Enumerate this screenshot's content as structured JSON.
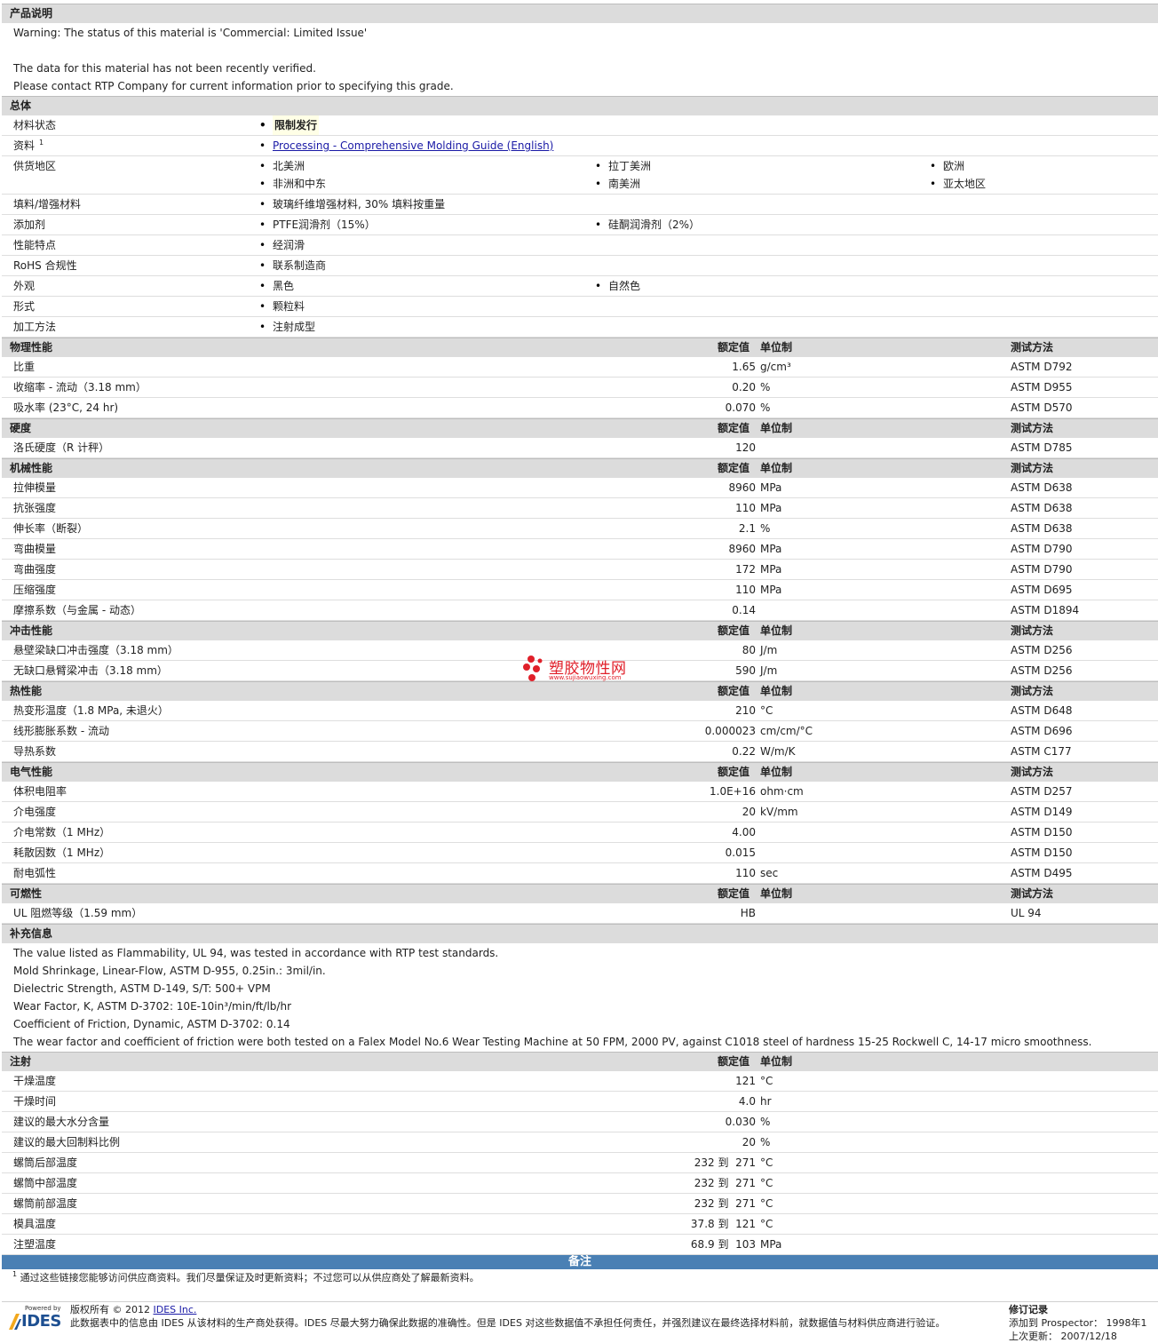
{
  "product": {
    "title": "产品说明",
    "lines": [
      "Warning: The status of this material is 'Commercial: Limited Issue'",
      "",
      "The data for this material has not been recently verified.",
      "Please contact RTP Company for current information prior to specifying this grade."
    ]
  },
  "general": {
    "title": "总体",
    "rows": [
      {
        "label": "材料状态",
        "items": [
          "限制发行"
        ],
        "highlight": true
      },
      {
        "label": "资料",
        "sup": "1",
        "items": [
          "Processing - Comprehensive Molding Guide (English)"
        ],
        "link": true
      },
      {
        "label": "供货地区",
        "items": [
          "北美洲",
          "拉丁美洲",
          "欧洲",
          "非洲和中东",
          "南美洲",
          "亚太地区"
        ]
      },
      {
        "label": "填料/增强材料",
        "items": [
          "玻璃纤维增强材料, 30% 填料按重量"
        ]
      },
      {
        "label": "添加剂",
        "items": [
          "PTFE润滑剂（15%）",
          "硅酮润滑剂（2%）"
        ]
      },
      {
        "label": "性能特点",
        "items": [
          "经润滑"
        ]
      },
      {
        "label": "RoHS 合规性",
        "items": [
          "联系制造商"
        ]
      },
      {
        "label": "外观",
        "items": [
          "黑色",
          "自然色"
        ]
      },
      {
        "label": "形式",
        "items": [
          "颗粒料"
        ]
      },
      {
        "label": "加工方法",
        "items": [
          "注射成型"
        ]
      }
    ]
  },
  "headers": {
    "nominal": "额定值",
    "unit": "单位制",
    "test": "测试方法"
  },
  "sections": [
    {
      "title": "物理性能",
      "test": true,
      "rows": [
        {
          "label": "比重",
          "value": "1.65",
          "unit": "g/cm³",
          "test": "ASTM D792"
        },
        {
          "label": "收缩率 - 流动（3.18 mm）",
          "value": "0.20",
          "unit": "%",
          "test": "ASTM D955"
        },
        {
          "label": "吸水率 (23°C, 24 hr)",
          "value": "0.070",
          "unit": "%",
          "test": "ASTM D570"
        }
      ]
    },
    {
      "title": "硬度",
      "test": true,
      "rows": [
        {
          "label": "洛氏硬度（R 计秤）",
          "value": "120",
          "unit": "",
          "test": "ASTM D785"
        }
      ]
    },
    {
      "title": "机械性能",
      "test": true,
      "rows": [
        {
          "label": "拉伸模量",
          "value": "8960",
          "unit": "MPa",
          "test": "ASTM D638"
        },
        {
          "label": "抗张强度",
          "value": "110",
          "unit": "MPa",
          "test": "ASTM D638"
        },
        {
          "label": "伸长率（断裂）",
          "value": "2.1",
          "unit": "%",
          "test": "ASTM D638"
        },
        {
          "label": "弯曲模量",
          "value": "8960",
          "unit": "MPa",
          "test": "ASTM D790"
        },
        {
          "label": "弯曲强度",
          "value": "172",
          "unit": "MPa",
          "test": "ASTM D790"
        },
        {
          "label": "压缩强度",
          "value": "110",
          "unit": "MPa",
          "test": "ASTM D695"
        },
        {
          "label": "摩擦系数（与金属 - 动态）",
          "value": "0.14",
          "unit": "",
          "test": "ASTM D1894"
        }
      ]
    },
    {
      "title": "冲击性能",
      "test": true,
      "rows": [
        {
          "label": "悬壁梁缺口冲击强度（3.18 mm）",
          "value": "80",
          "unit": "J/m",
          "test": "ASTM D256"
        },
        {
          "label": "无缺口悬臂梁冲击（3.18 mm）",
          "value": "590",
          "unit": "J/m",
          "test": "ASTM D256"
        }
      ]
    },
    {
      "title": "热性能",
      "test": true,
      "rows": [
        {
          "label": "热变形温度（1.8 MPa, 未退火）",
          "value": "210",
          "unit": "°C",
          "test": "ASTM D648"
        },
        {
          "label": "线形膨胀系数 - 流动",
          "value": "0.000023",
          "unit": "cm/cm/°C",
          "test": "ASTM D696"
        },
        {
          "label": "导热系数",
          "value": "0.22",
          "unit": "W/m/K",
          "test": "ASTM C177"
        }
      ]
    },
    {
      "title": "电气性能",
      "test": true,
      "rows": [
        {
          "label": "体积电阻率",
          "value": "1.0E+16",
          "unit": "ohm·cm",
          "test": "ASTM D257"
        },
        {
          "label": "介电强度",
          "value": "20",
          "unit": "kV/mm",
          "test": "ASTM D149"
        },
        {
          "label": "介电常数（1 MHz）",
          "value": "4.00",
          "unit": "",
          "test": "ASTM D150"
        },
        {
          "label": "耗散因数（1 MHz）",
          "value": "0.015",
          "unit": "",
          "test": "ASTM D150"
        },
        {
          "label": "耐电弧性",
          "value": "110",
          "unit": "sec",
          "test": "ASTM D495"
        }
      ]
    },
    {
      "title": "可燃性",
      "test": true,
      "rows": [
        {
          "label": "UL 阻燃等级（1.59 mm）",
          "value": "HB",
          "unit": "",
          "test": "UL 94"
        }
      ]
    }
  ],
  "supplement": {
    "title": "补充信息",
    "lines": [
      "The value listed as Flammability, UL 94, was tested in accordance with RTP test standards.",
      "Mold Shrinkage, Linear-Flow, ASTM D-955, 0.25in.: 3mil/in.",
      "Dielectric Strength, ASTM D-149, S/T: 500+ VPM",
      "Wear Factor, K, ASTM D-3702: 10E-10in³/min/ft/lb/hr",
      "Coefficient of Friction, Dynamic, ASTM D-3702: 0.14",
      "The wear factor and coefficient of friction were both tested on a Falex Model No.6 Wear Testing Machine at 50 FPM, 2000 PV, against C1018 steel of hardness 15-25 Rockwell C, 14-17 micro smoothness."
    ]
  },
  "injection": {
    "title": "注射",
    "rows": [
      {
        "label": "干燥温度",
        "value": "121",
        "unit": "°C"
      },
      {
        "label": "干燥时间",
        "value": "4.0",
        "unit": "hr"
      },
      {
        "label": "建议的最大水分含量",
        "value": "0.030",
        "unit": "%"
      },
      {
        "label": "建议的最大回制料比例",
        "value": "20",
        "unit": "%"
      },
      {
        "label": "螺筒后部温度",
        "value": "232 到  271",
        "unit": "°C"
      },
      {
        "label": "螺筒中部温度",
        "value": "232 到  271",
        "unit": "°C"
      },
      {
        "label": "螺筒前部温度",
        "value": "232 到  271",
        "unit": "°C"
      },
      {
        "label": "模具温度",
        "value": "37.8 到  121",
        "unit": "°C"
      },
      {
        "label": "注塑温度",
        "value": "68.9 到  103",
        "unit": "MPa"
      }
    ]
  },
  "notes": {
    "title": "备注",
    "footnote_mark": "1",
    "footnote": "通过这些链接您能够访问供应商资料。我们尽量保证及时更新资料；不过您可以从供应商处了解最新资料。"
  },
  "footer": {
    "powered_by": "Powered by",
    "brand": "IDES",
    "copyright_prefix": "版权所有  © 2012 ",
    "copyright_link": "IDES Inc.",
    "disclaimer": "此数据表中的信息由  IDES 从该材料的生产商处获得。IDES 尽最大努力确保此数据的准确性。但是  IDES 对这些数据值不承担任何责任，并强烈建议在最终选择材料前，就数据值与材料供应商进行验证。",
    "revision_title": "修订记录",
    "added_label": "添加到  Prospector：",
    "added_value": "1998年1",
    "updated_label": "上次更新：",
    "updated_value": "2007/12/18"
  },
  "watermark": {
    "name": "塑胶物性网",
    "url": "www.sujiaowuxing.com"
  }
}
